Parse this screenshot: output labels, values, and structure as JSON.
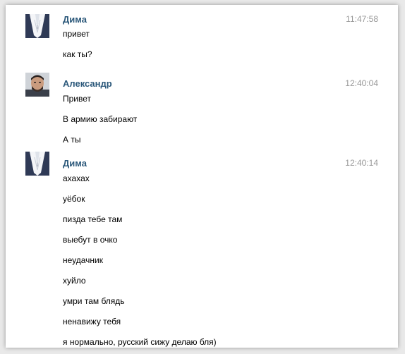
{
  "messages": [
    {
      "author": "Дима",
      "time": "11:47:58",
      "avatar": "dima-avatar",
      "lines": [
        "привет",
        "как ты?"
      ]
    },
    {
      "author": "Александр",
      "time": "12:40:04",
      "avatar": "alexander-avatar",
      "lines": [
        "Привет",
        "В армию забирают",
        "А ты"
      ]
    },
    {
      "author": "Дима",
      "time": "12:40:14",
      "avatar": "dima-avatar",
      "lines": [
        "ахахах",
        "уёбок",
        "пизда тебе там",
        "выебут в очко",
        "неудачник",
        "хуйло",
        "умри там блядь",
        "ненавижу тебя",
        "я нормально, русский сижу делаю бля)"
      ]
    }
  ],
  "colors": {
    "author": "#2b587a",
    "time": "#999999",
    "text": "#000000"
  }
}
